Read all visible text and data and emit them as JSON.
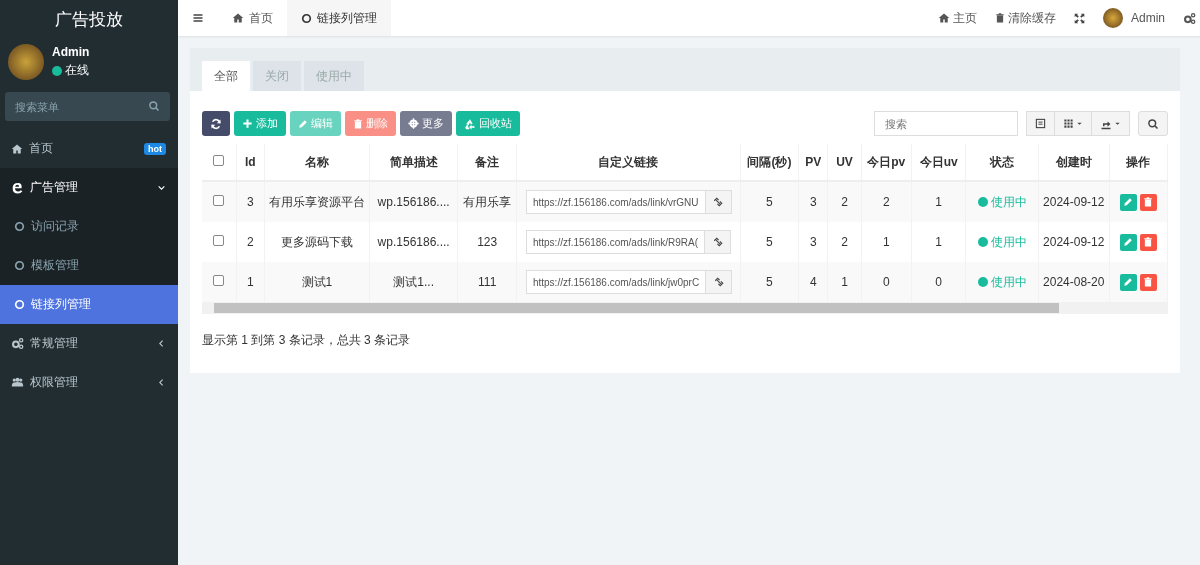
{
  "sidebar": {
    "title": "广告投放",
    "user": {
      "name": "Admin",
      "status": "在线"
    },
    "search": {
      "placeholder": "搜索菜单"
    },
    "items": [
      {
        "kind": "link",
        "label": "首页",
        "badge": "hot",
        "selected": false
      },
      {
        "kind": "group",
        "label": "广告管理",
        "expanded": true,
        "selected": false,
        "children": [
          {
            "label": "访问记录",
            "selected": false
          },
          {
            "label": "模板管理",
            "selected": false
          },
          {
            "label": "链接列管理",
            "selected": true
          }
        ]
      },
      {
        "kind": "group",
        "label": "常规管理",
        "expanded": false,
        "selected": false
      },
      {
        "kind": "group",
        "label": "权限管理",
        "expanded": false,
        "selected": false
      }
    ]
  },
  "topbar": {
    "tabs": [
      {
        "label": "首页",
        "selected": false
      },
      {
        "label": "链接列管理",
        "selected": true
      }
    ],
    "links": [
      "主页",
      "清除缓存"
    ],
    "user": "Admin"
  },
  "panel": {
    "tabs": [
      {
        "label": "全部",
        "selected": true
      },
      {
        "label": "关闭",
        "selected": false
      },
      {
        "label": "使用中",
        "selected": false
      }
    ],
    "buttons": [
      {
        "kind": "refresh",
        "disabled": false
      },
      {
        "kind": "add",
        "label": "添加",
        "disabled": false
      },
      {
        "kind": "edit",
        "label": "编辑",
        "disabled": true
      },
      {
        "kind": "delete",
        "label": "删除",
        "disabled": true
      },
      {
        "kind": "more",
        "label": "更多",
        "disabled": false
      },
      {
        "kind": "recycle",
        "label": "回收站",
        "disabled": false
      }
    ],
    "search": {
      "placeholder": "搜索"
    },
    "table": {
      "all_checked": false,
      "columns": [
        "Id",
        "名称",
        "简单描述",
        "备注",
        "自定义链接",
        "间隔(秒)",
        "PV",
        "UV",
        "今日pv",
        "今日uv",
        "状态",
        "创建时",
        "操作"
      ],
      "rows": [
        {
          "checked": false,
          "id": "3",
          "name": "有用乐享资源平台",
          "desc": "wp.156186....",
          "note": "有用乐享",
          "link": "https://zf.156186.com/ads/link/vrGNU",
          "interval": "5",
          "pv": "3",
          "uv": "2",
          "today_pv": "2",
          "today_uv": "1",
          "status": {
            "label": "使用中",
            "color": "#18bc9c"
          },
          "created": "2024-09-12"
        },
        {
          "checked": false,
          "id": "2",
          "name": "更多源码下载",
          "desc": "wp.156186....",
          "note": "123",
          "link": "https://zf.156186.com/ads/link/R9RA(",
          "interval": "5",
          "pv": "3",
          "uv": "2",
          "today_pv": "1",
          "today_uv": "1",
          "status": {
            "label": "使用中",
            "color": "#18bc9c"
          },
          "created": "2024-09-12"
        },
        {
          "checked": false,
          "id": "1",
          "name": "测试1",
          "desc": "测试1...",
          "note": "111",
          "link": "https://zf.156186.com/ads/link/jw0prC",
          "interval": "5",
          "pv": "4",
          "uv": "1",
          "today_pv": "0",
          "today_uv": "0",
          "status": {
            "label": "使用中",
            "color": "#18bc9c"
          },
          "created": "2024-08-20"
        }
      ]
    },
    "footer": "显示第 1 到第 3 条记录，总共 3 条记录"
  }
}
